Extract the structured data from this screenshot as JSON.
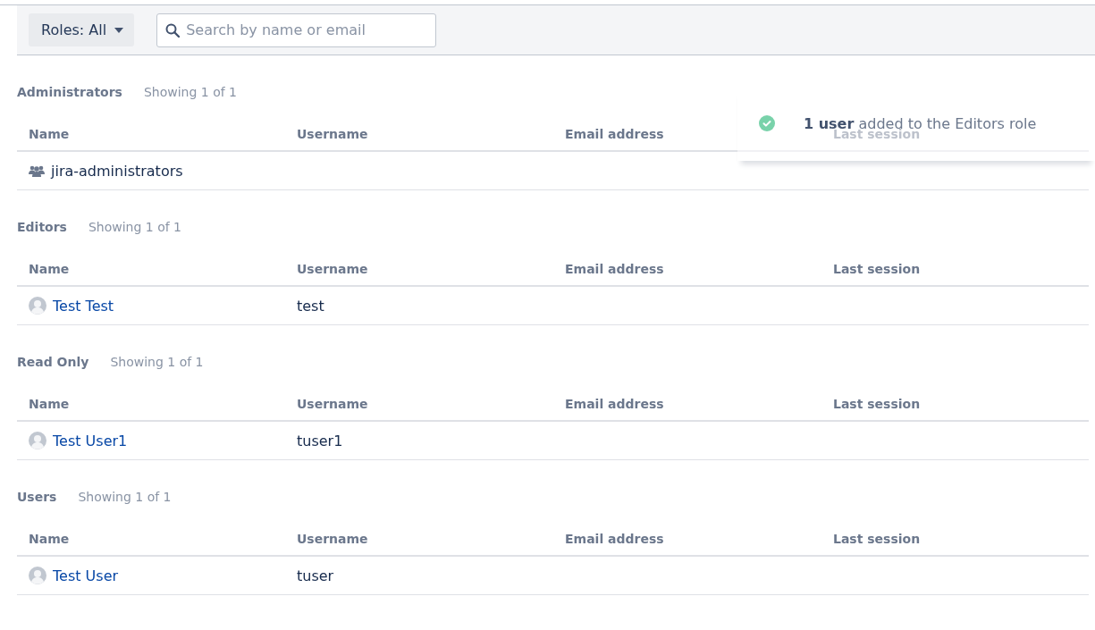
{
  "toolbar": {
    "roles_filter": "Roles: All",
    "search": {
      "placeholder": "Search by name or email"
    }
  },
  "sections": [
    {
      "title": "Administrators",
      "showing": "Showing 1 of 1",
      "columns": [
        "Name",
        "Username",
        "Email address",
        "Last session"
      ],
      "rows": [
        {
          "kind": "group",
          "name": "jira-administrators"
        }
      ]
    },
    {
      "title": "Editors",
      "showing": "Showing 1 of 1",
      "columns": [
        "Name",
        "Username",
        "Email address",
        "Last session"
      ],
      "rows": [
        {
          "kind": "user",
          "name": "Test Test",
          "username": "test"
        }
      ]
    },
    {
      "title": "Read Only",
      "showing": "Showing 1 of 1",
      "columns": [
        "Name",
        "Username",
        "Email address",
        "Last session"
      ],
      "rows": [
        {
          "kind": "user",
          "name": "Test User1",
          "username": "tuser1"
        }
      ]
    },
    {
      "title": "Users",
      "showing": "Showing 1 of 1",
      "columns": [
        "Name",
        "Username",
        "Email address",
        "Last session"
      ],
      "rows": [
        {
          "kind": "user",
          "name": "Test User",
          "username": "tuser"
        }
      ]
    }
  ],
  "toast": {
    "message": "**1 user** added to the Editors role"
  }
}
